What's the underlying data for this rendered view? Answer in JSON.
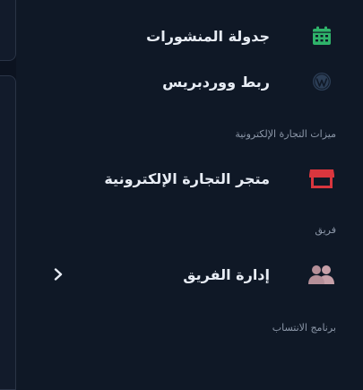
{
  "sidebar": {
    "items": [
      {
        "label": "جدولة المنشورات",
        "icon": "calendar-icon",
        "color": "#2fb36a"
      },
      {
        "label": "ربط ووردبريس",
        "icon": "wordpress-icon",
        "color": "#2c3e56"
      }
    ],
    "ecommerce": {
      "section_label": "ميزات التجارة الإلكترونية",
      "item": {
        "label": "متجر التجارة الإلكترونية",
        "icon": "store-icon",
        "color": "#d9363e"
      }
    },
    "team": {
      "section_label": "فريق",
      "item": {
        "label": "إدارة الفريق",
        "icon": "users-icon",
        "color": "#c7a0a8",
        "expand_icon": "chevron-right-icon"
      }
    },
    "affiliate": {
      "section_label": "برنامج الانتساب"
    }
  }
}
